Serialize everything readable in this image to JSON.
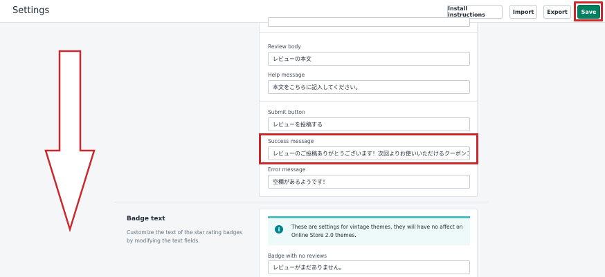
{
  "header": {
    "title": "Settings",
    "buttons": {
      "install": "Install instructions",
      "import": "Import",
      "export": "Export",
      "save": "Save"
    }
  },
  "form": {
    "review_body": {
      "label": "Review body",
      "value": "レビューの本文"
    },
    "help_message": {
      "label": "Help message",
      "value": "本文をこちらに記入してください。"
    },
    "submit_button": {
      "label": "Submit button",
      "value": "レビューを投稿する"
    },
    "success_message": {
      "label": "Success message",
      "value": "レビューのご投稿ありがとうございます！次回よりお使いいただけるクーポンコー"
    },
    "error_message": {
      "label": "Error message",
      "value": "空欄があるようです！"
    }
  },
  "badge_section": {
    "title": "Badge text",
    "description": "Customize the text of the star rating badges by modifying the text fields.",
    "banner": {
      "icon": "info-icon",
      "text": "These are settings for vintage themes, they will have no affect on Online Store 2.0 themes."
    },
    "badge_no_reviews": {
      "label": "Badge with no reviews",
      "value": "レビューがまだありません。"
    }
  },
  "colors": {
    "accent_save": "#008060",
    "highlight": "#c9282d",
    "banner_border": "#47c1bf"
  }
}
